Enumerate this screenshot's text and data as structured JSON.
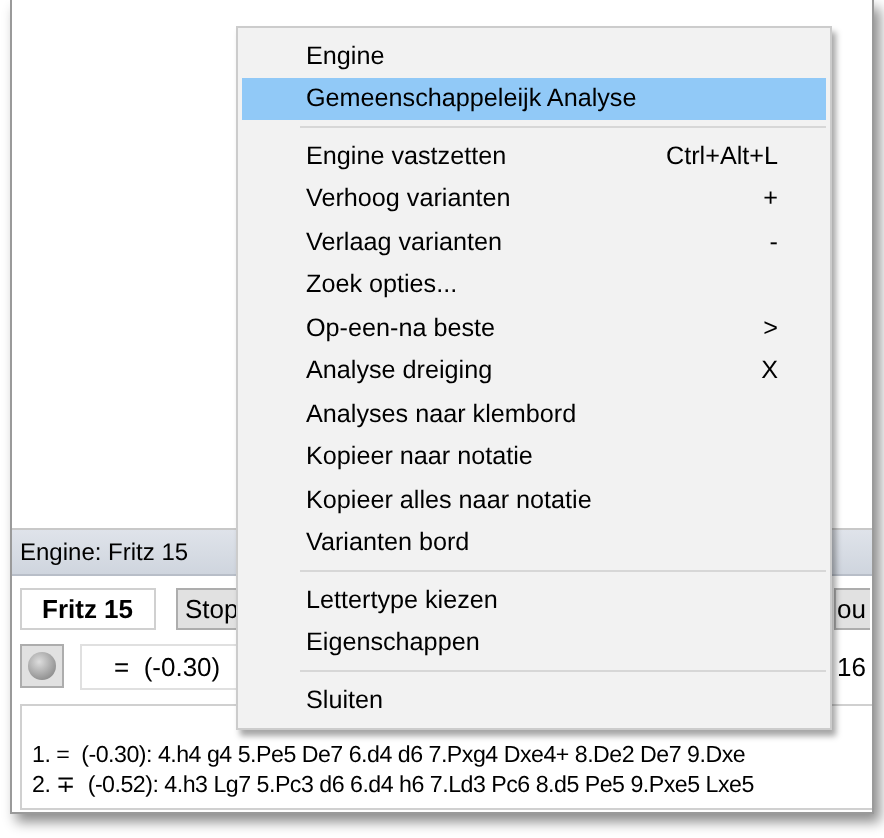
{
  "engine_pane": {
    "title": "Engine: Fritz 15",
    "engine_name": "Fritz 15",
    "stop_button": "Stop",
    "cut_button": "ou",
    "status_light": {
      "on": false
    },
    "evaluation": "=  (-0.30)",
    "depth": "16",
    "lines": [
      {
        "text": "1. =  (-0.30): 4.h4 g4 5.Pe5 De7 6.d4 d6 7.Pxg4 Dxe4+ 8.De2 De7 9.Dxe"
      },
      {
        "text": "2. ∓  (-0.52): 4.h3 Lg7 5.Pc3 d6 6.d4 h6 7.Ld3 Pc6 8.d5 Pe5 9.Pxe5 Lxe5"
      }
    ]
  },
  "context_menu": {
    "items": [
      {
        "kind": "item",
        "label": "Engine",
        "selected": false
      },
      {
        "kind": "item",
        "label": "Gemeenschappeleijk Analyse",
        "selected": true
      },
      {
        "kind": "separator"
      },
      {
        "kind": "item",
        "label": "Engine vastzetten",
        "shortcut": "Ctrl+Alt+L",
        "selected": false
      },
      {
        "kind": "item",
        "label": "Verhoog varianten",
        "shortcut": "+",
        "selected": false
      },
      {
        "kind": "item",
        "label": "Verlaag varianten",
        "shortcut": "-",
        "selected": false
      },
      {
        "kind": "item",
        "label": "Zoek opties...",
        "selected": false
      },
      {
        "kind": "item",
        "label": "Op-een-na beste",
        "shortcut": ">",
        "selected": false
      },
      {
        "kind": "item",
        "label": "Analyse dreiging",
        "shortcut": "X",
        "selected": false
      },
      {
        "kind": "item",
        "label": "Analyses naar klembord",
        "selected": false
      },
      {
        "kind": "item",
        "label": "Kopieer naar notatie",
        "selected": false
      },
      {
        "kind": "item",
        "label": "Kopieer alles naar notatie",
        "selected": false
      },
      {
        "kind": "item",
        "label": "Varianten bord",
        "selected": false
      },
      {
        "kind": "separator"
      },
      {
        "kind": "item",
        "label": "Lettertype kiezen",
        "selected": false
      },
      {
        "kind": "item",
        "label": "Eigenschappen",
        "selected": false
      },
      {
        "kind": "separator"
      },
      {
        "kind": "item",
        "label": "Sluiten",
        "selected": false
      }
    ]
  }
}
